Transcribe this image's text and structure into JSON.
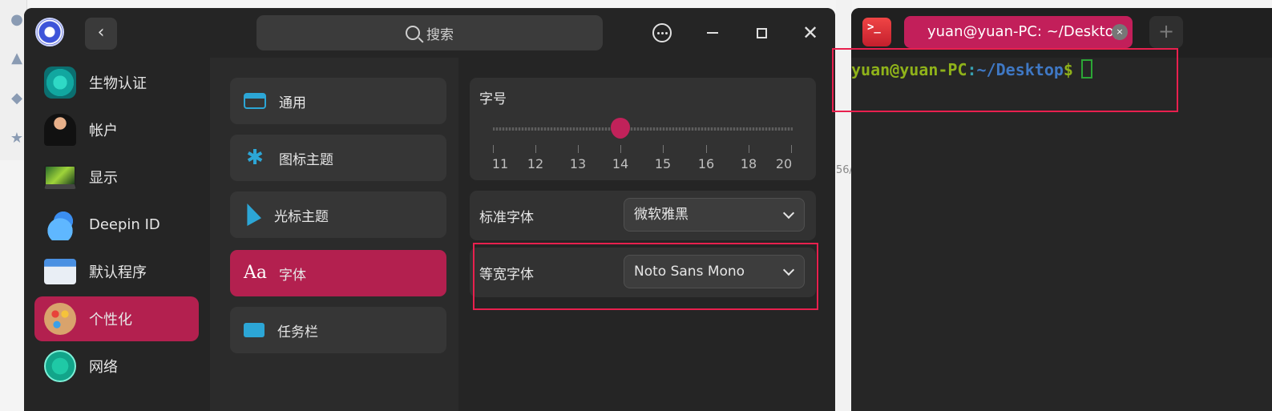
{
  "background": {
    "partial_text": "56/"
  },
  "settings": {
    "search_placeholder": "搜索",
    "nav": [
      {
        "label": "生物认证",
        "icon": "fingerprint-icon"
      },
      {
        "label": "帐户",
        "icon": "account-avatar-icon"
      },
      {
        "label": "显示",
        "icon": "display-icon"
      },
      {
        "label": "Deepin ID",
        "icon": "cloud-icon"
      },
      {
        "label": "默认程序",
        "icon": "default-apps-icon"
      },
      {
        "label": "个性化",
        "icon": "palette-icon",
        "active": true
      },
      {
        "label": "网络",
        "icon": "network-icon"
      }
    ],
    "sub_items": [
      {
        "label": "通用",
        "icon": "window-icon"
      },
      {
        "label": "图标主题",
        "icon": "snowflake-icon"
      },
      {
        "label": "光标主题",
        "icon": "cursor-icon"
      },
      {
        "label": "字体",
        "icon": "font-icon",
        "active": true,
        "glyph": "Aa"
      },
      {
        "label": "任务栏",
        "icon": "taskbar-icon"
      }
    ],
    "font_size": {
      "title": "字号",
      "ticks": [
        "11",
        "12",
        "13",
        "14",
        "15",
        "16",
        "18",
        "20"
      ],
      "selected": "14"
    },
    "standard_font": {
      "label": "标准字体",
      "value": "微软雅黑"
    },
    "mono_font": {
      "label": "等宽字体",
      "value": "Noto Sans Mono"
    },
    "accent_color": "#b3204f"
  },
  "terminal": {
    "tab_title": "yuan@yuan-PC: ~/Desktop",
    "tab_close": "×",
    "add_tab": "+",
    "prompt_user": "yuan@yuan-PC",
    "prompt_colon": ":",
    "prompt_path": "~/Desktop",
    "prompt_dollar": "$"
  }
}
